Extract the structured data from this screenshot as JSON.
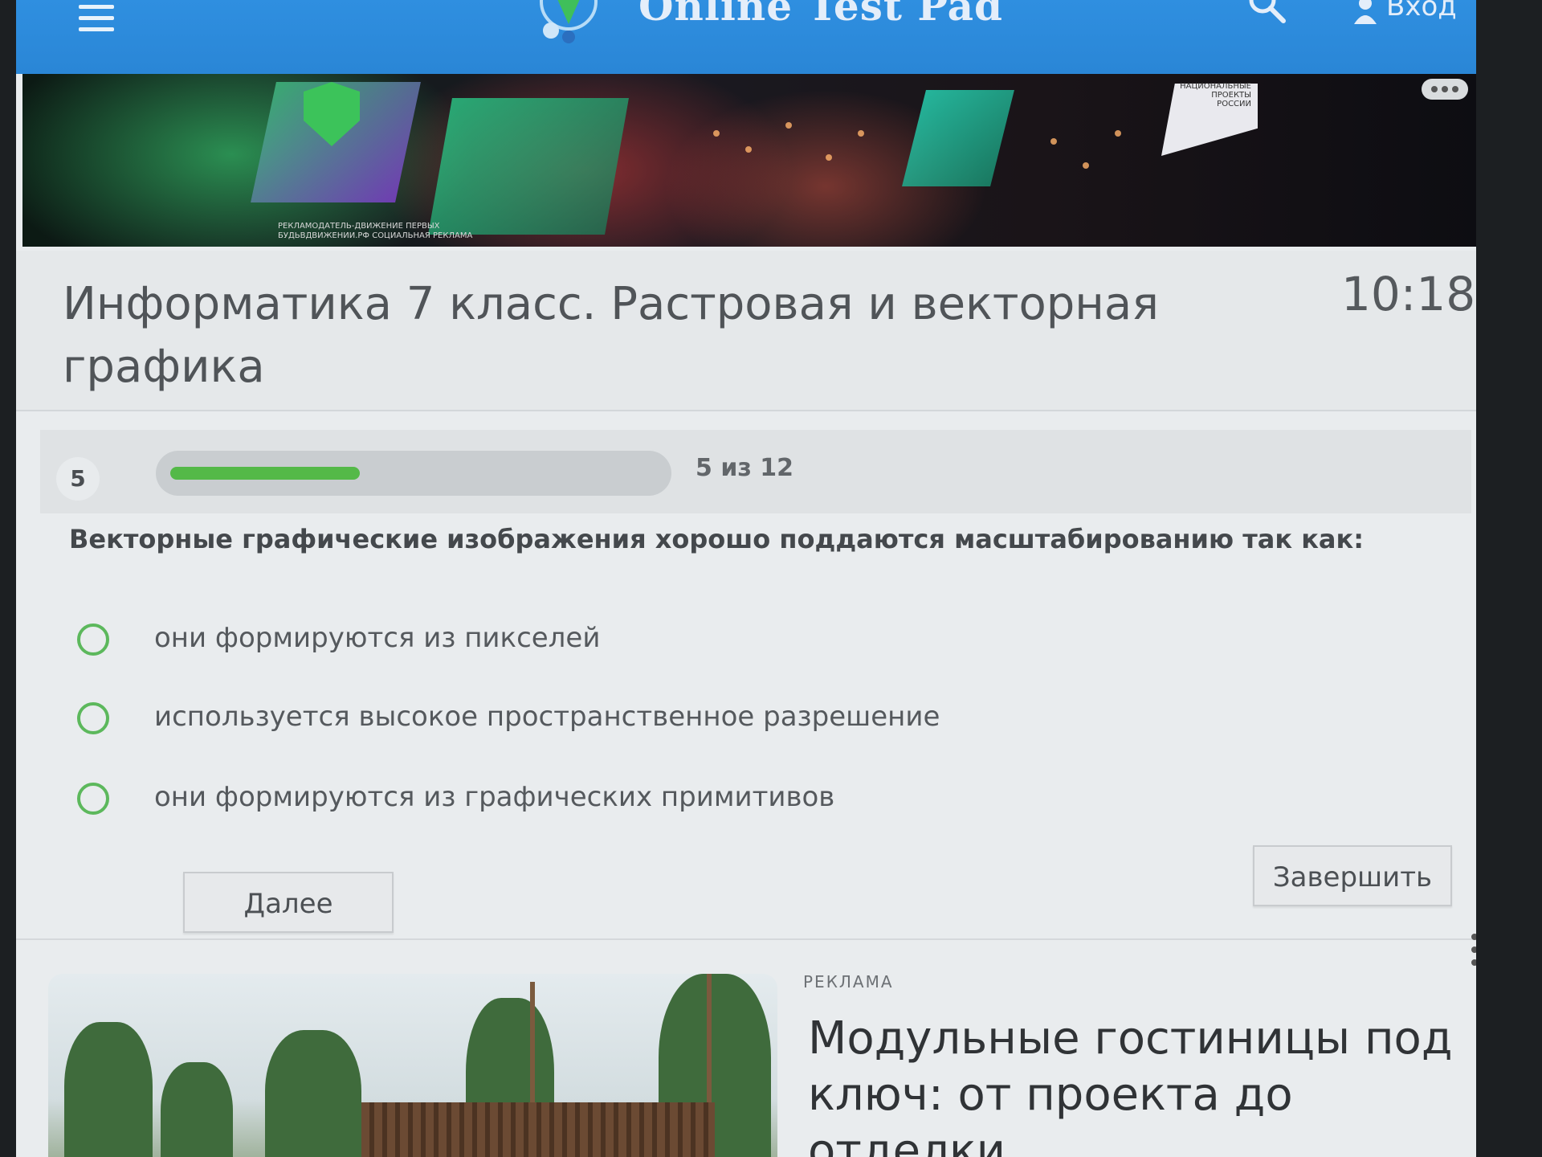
{
  "header": {
    "brand": "Online Test Pad",
    "login_label": "Вход"
  },
  "banner": {
    "caption": "РЕКЛАМОДАТЕЛЬ-ДВИЖЕНИЕ ПЕРВЫХ БУДЬВДВИЖЕНИИ.РФ СОЦИАЛЬНАЯ РЕКЛАМА",
    "badge_text": "НАЦИОНАЛЬНЫЕ ПРОЕКТЫ РОССИИ"
  },
  "test": {
    "title": "Информатика 7 класс. Растровая и векторная графика",
    "timer": "10:18"
  },
  "progress": {
    "number": "5",
    "fraction": 0.39,
    "text": "5 из 12"
  },
  "question": {
    "text": "Векторные графические изображения хорошо поддаются масштабированию так как:",
    "answers": [
      "они формируются из пикселей",
      "используется высокое пространственное разрешение",
      "они формируются из графических примитивов"
    ]
  },
  "buttons": {
    "next": "Далее",
    "finish": "Завершить"
  },
  "ad": {
    "label": "РЕКЛАМА",
    "title": "Модульные гостиницы под ключ: от проекта до отделки"
  },
  "colors": {
    "header": "#2f8fe0",
    "accent_green": "#54b948",
    "radio_green": "#5cb85c"
  }
}
